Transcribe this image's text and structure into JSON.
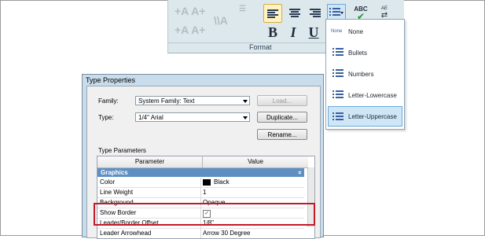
{
  "ribbon": {
    "panel_label": "Format",
    "bold_label": "B",
    "italic_label": "I",
    "underline_label": "U",
    "spell_label": "ABC",
    "find_label": "AE"
  },
  "list_dropdown": {
    "items": [
      {
        "icon_text": "None",
        "label": "None"
      },
      {
        "label": "Bullets"
      },
      {
        "label": "Numbers"
      },
      {
        "label": "Letter-Lowercase"
      },
      {
        "label": "Letter-Uppercase",
        "selected": true
      }
    ]
  },
  "dialog": {
    "title": "Type Properties",
    "family_label": "Family:",
    "family_value": "System Family: Text",
    "type_label": "Type:",
    "type_value": "1/4\" Arial",
    "load_button": "Load...",
    "duplicate_button": "Duplicate...",
    "rename_button": "Rename...",
    "section_label": "Type Parameters",
    "columns": [
      "Parameter",
      "Value"
    ],
    "group": "Graphics",
    "group_toggle": "»",
    "rows": [
      {
        "param": "Color",
        "value": "Black"
      },
      {
        "param": "Line Weight",
        "value": "1"
      },
      {
        "param": "Background",
        "value": "Opaque"
      },
      {
        "param": "Show Border",
        "value": "✓"
      },
      {
        "param": "Leader/Border Offset",
        "value": "1/8\""
      },
      {
        "param": "Leader Arrowhead",
        "value": "Arrow 30 Degree"
      }
    ]
  },
  "colors": {
    "accent_red": "#c21a26",
    "group_blue": "#5f8fc2",
    "selected_item": "#cfe6f7",
    "color_swatch": "#000000"
  }
}
